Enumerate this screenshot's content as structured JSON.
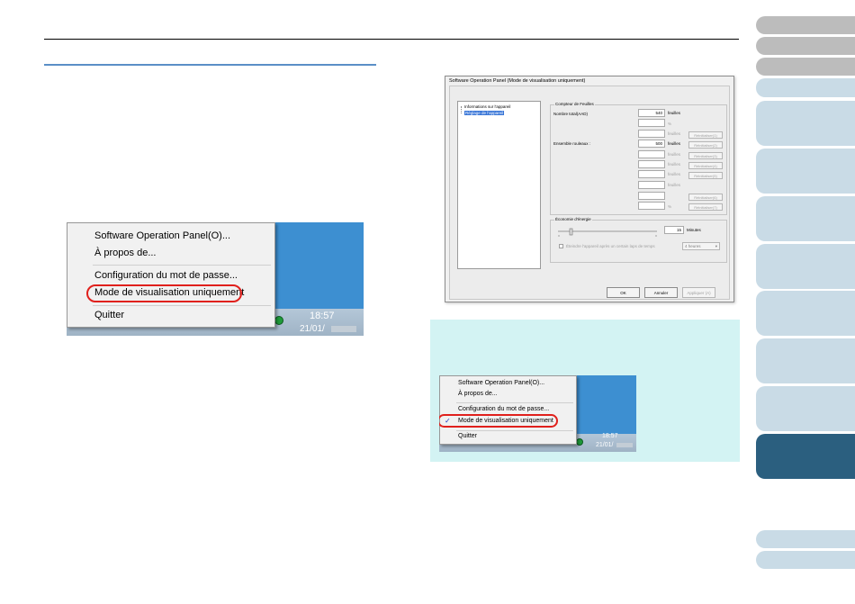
{
  "nav_tabs": [
    {
      "state": "grey"
    },
    {
      "state": "grey"
    },
    {
      "state": "grey"
    },
    {
      "state": "light"
    },
    {
      "state": "light"
    },
    {
      "state": "light"
    },
    {
      "state": "light"
    },
    {
      "state": "light"
    },
    {
      "state": "light"
    },
    {
      "state": "light"
    },
    {
      "state": "light"
    },
    {
      "state": "active"
    },
    {
      "state": "light"
    },
    {
      "state": "light"
    }
  ],
  "menu": {
    "items": [
      "Software Operation Panel(O)...",
      "À propos de...",
      "Configuration du mot de passe...",
      "Mode de visualisation uniquement",
      "Quitter"
    ],
    "clock_time": "18:57",
    "clock_date": "21/01/"
  },
  "dialog": {
    "title": "Software Operation Panel (Mode de visualisation uniquement)",
    "tree": [
      "Informations sur l'appareil",
      "Réglage de l'appareil"
    ],
    "sheet_counter_group": "Compteur de Feuilles",
    "total_label": "Nombre total(AAD)",
    "total_value": "540",
    "roller_label": "Ensemble rouleaux :",
    "roller_value": "500",
    "unit_sheets": "feuilles",
    "unit_percent": "%",
    "reset_buttons": [
      "Réinitialiser(1)",
      "Réinitialiser(2)",
      "Réinitialiser(3)",
      "Réinitialiser(4)",
      "Réinitialiser(5)",
      "Réinitialiser(6)",
      "Réinitialiser(7)"
    ],
    "energy_group": "Économie d'énergie",
    "energy_value": "15",
    "energy_unit": "Minutes",
    "energy_level": 0.12,
    "auto_off_label": "Éteindre l'appareil après un certain laps de temps",
    "auto_off_value": "4 heures",
    "buttons": {
      "ok": "OK",
      "cancel": "Annuler",
      "apply": "Appliquer (A)"
    }
  }
}
